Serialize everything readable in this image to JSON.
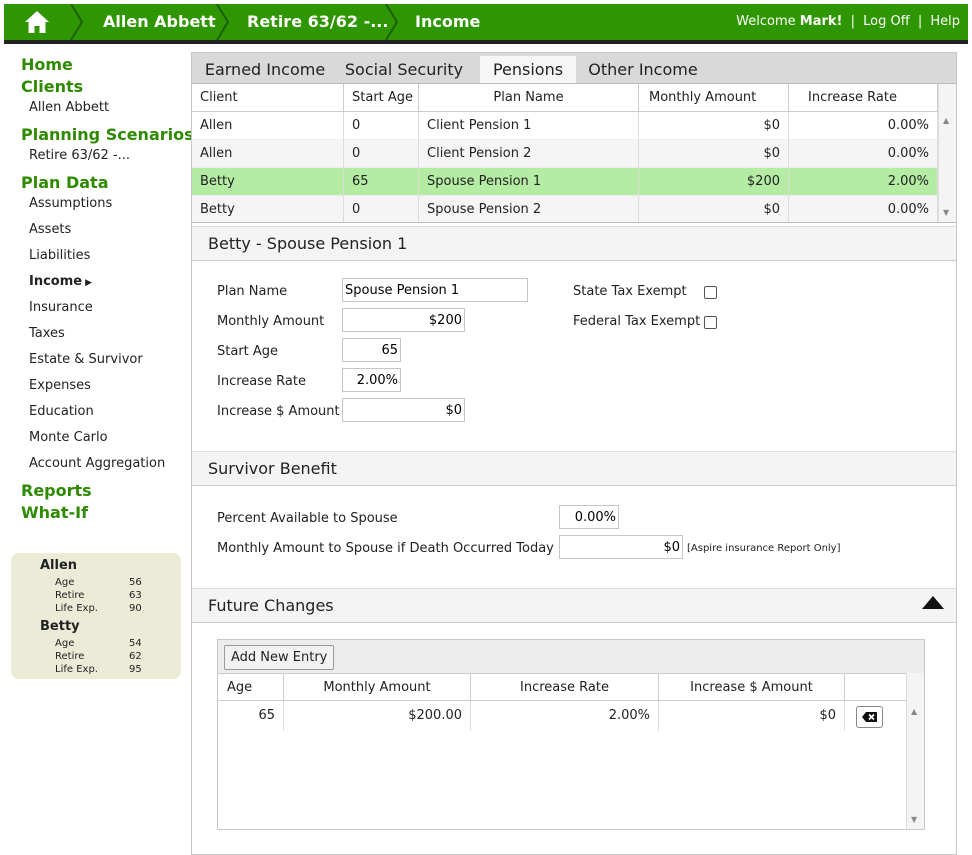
{
  "header": {
    "breadcrumbs": [
      "Allen Abbett",
      "Retire 63/62 -...",
      "Income"
    ],
    "welcome_prefix": "Welcome",
    "user": "Mark!",
    "separator": "|",
    "logoff": "Log Off",
    "help": "Help"
  },
  "sidebar": {
    "home": "Home",
    "clients": "Clients",
    "client_name": "Allen Abbett",
    "planning_scenarios": "Planning Scenarios",
    "scenario_name": "Retire 63/62 -...",
    "plan_data": "Plan Data",
    "plan_items": [
      "Assumptions",
      "Assets",
      "Liabilities",
      "Income",
      "Insurance",
      "Taxes",
      "Estate & Survivor",
      "Expenses",
      "Education",
      "Monte Carlo",
      "Account Aggregation"
    ],
    "active_item": "Income",
    "reports": "Reports",
    "whatif": "What-If"
  },
  "profile": {
    "people": [
      {
        "name": "Allen",
        "age_label": "Age",
        "age": "56",
        "retire_label": "Retire",
        "retire": "63",
        "life_label": "Life Exp.",
        "life": "90"
      },
      {
        "name": "Betty",
        "age_label": "Age",
        "age": "54",
        "retire_label": "Retire",
        "retire": "62",
        "life_label": "Life Exp.",
        "life": "95"
      }
    ]
  },
  "tabs": [
    "Earned Income",
    "Social Security",
    "Pensions",
    "Other Income"
  ],
  "active_tab": "Pensions",
  "grid": {
    "columns": [
      "Client",
      "Start Age",
      "Plan Name",
      "Monthly Amount",
      "Increase Rate"
    ],
    "rows": [
      {
        "client": "Allen",
        "start_age": "0",
        "plan": "Client Pension 1",
        "monthly": "$0",
        "rate": "0.00%"
      },
      {
        "client": "Allen",
        "start_age": "0",
        "plan": "Client Pension 2",
        "monthly": "$0",
        "rate": "0.00%"
      },
      {
        "client": "Betty",
        "start_age": "65",
        "plan": "Spouse Pension 1",
        "monthly": "$200",
        "rate": "2.00%"
      },
      {
        "client": "Betty",
        "start_age": "0",
        "plan": "Spouse Pension 2",
        "monthly": "$0",
        "rate": "0.00%"
      }
    ],
    "selected_row": 2
  },
  "detail": {
    "title": "Betty - Spouse Pension 1",
    "plan_name_label": "Plan Name",
    "plan_name": "Spouse Pension 1",
    "monthly_label": "Monthly Amount",
    "monthly": "$200",
    "start_age_label": "Start Age",
    "start_age": "65",
    "increase_rate_label": "Increase Rate",
    "increase_rate": "2.00%",
    "increase_amt_label": "Increase $ Amount",
    "increase_amt": "$0",
    "state_tax_label": "State Tax Exempt",
    "federal_tax_label": "Federal Tax Exempt"
  },
  "survivor": {
    "title": "Survivor Benefit",
    "percent_label": "Percent Available to Spouse",
    "percent": "0.00%",
    "monthly_label": "Monthly Amount to Spouse if Death Occurred Today",
    "monthly": "$0",
    "note": "[Aspire insurance Report Only]"
  },
  "future": {
    "title": "Future Changes",
    "add_label": "Add New Entry",
    "columns": [
      "Age",
      "Monthly Amount",
      "Increase Rate",
      "Increase $ Amount"
    ],
    "rows": [
      {
        "age": "65",
        "monthly": "$200.00",
        "rate": "2.00%",
        "amount": "$0"
      }
    ]
  },
  "colors": {
    "brand_green": "#2e9600",
    "selected_row": "#b4eca4",
    "nav_green": "#2e8a00"
  }
}
